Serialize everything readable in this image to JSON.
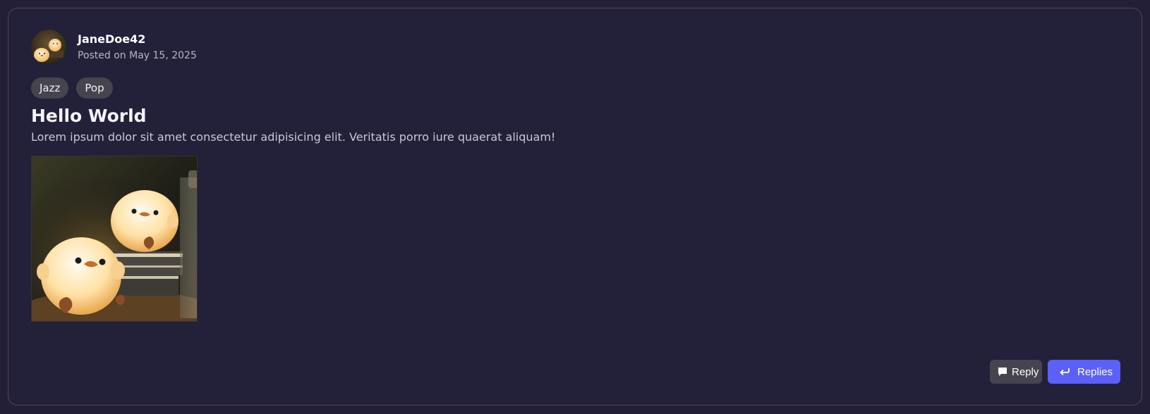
{
  "post": {
    "username": "JaneDoe42",
    "posted_on": "Posted on May 15, 2025",
    "tags": [
      "Jazz",
      "Pop"
    ],
    "title": "Hello World",
    "body": "Lorem ipsum dolor sit amet consectetur adipisicing elit. Veritatis porro iure quaerat aliquam!"
  },
  "actions": {
    "reply_label": "Reply",
    "replies_label": "Replies"
  },
  "icons": {
    "reply": "speech-bubble-icon",
    "replies": "return-arrow-icon"
  },
  "colors": {
    "background": "#221f37",
    "card_border": "#4a475e",
    "tag_background": "#45444f",
    "accent": "#5d5ff9"
  }
}
